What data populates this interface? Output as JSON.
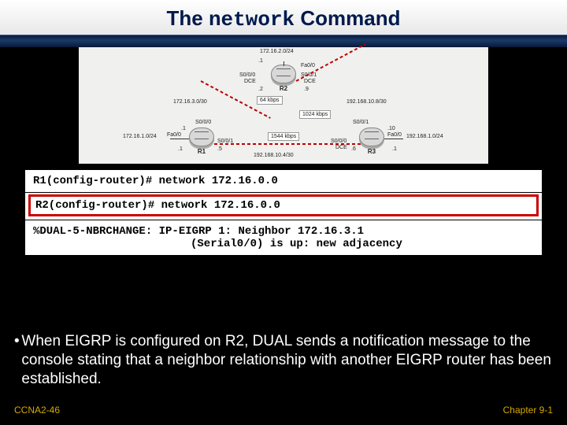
{
  "title": {
    "pre": "The ",
    "kw": "network",
    "post": " Command"
  },
  "topology": {
    "top_net": "172.16.2.0/24",
    "r2": {
      "name": "R2",
      "if_top": "Fa0/0",
      "addr_top": ".1",
      "if_left": "S0/0/0",
      "sub_left": "DCE",
      "addr_left": ".2",
      "if_right": "S0/0/1",
      "sub_right": "DCE",
      "addr_right": ".9"
    },
    "left_link": "172.16.3.0/30",
    "right_link": "192.168.10.8/30",
    "left_bw": "64 kbps",
    "right_bw": "1024 kbps",
    "bottom_bw": "1544 kbps",
    "r1": {
      "name": "R1",
      "if_left": "Fa0/0",
      "addr_left": ".1",
      "if_serial": "S0/0/0",
      "addr_serial": ".1",
      "if_serial2": "S0/0/1",
      "addr_serial2": ".5"
    },
    "r3": {
      "name": "R3",
      "if_right": "Fa0/0",
      "addr_right": ".1",
      "if_serial": "S0/0/1",
      "addr_serial": ".10",
      "if_serial2": "S0/0/0",
      "sub2": "DCE",
      "addr_serial2": ".6"
    },
    "left_lan": "172.16.1.0/24",
    "right_lan": "192.168.1.0/24",
    "bottom_link": "192.168.10.4/30"
  },
  "terminal": {
    "line1": "R1(config-router)# network 172.16.0.0",
    "line2": "R2(config-router)# network 172.16.0.0",
    "line3a": "%DUAL-5-NBRCHANGE: IP-EIGRP 1: Neighbor 172.16.3.1",
    "line3b": "(Serial0/0) is up: new adjacency"
  },
  "bullet": "When EIGRP is configured on R2, DUAL sends a notification message to the console stating that a neighbor relationship with another EIGRP router has been established.",
  "footer": {
    "left": "CCNA2-46",
    "right": "Chapter  9-1"
  }
}
